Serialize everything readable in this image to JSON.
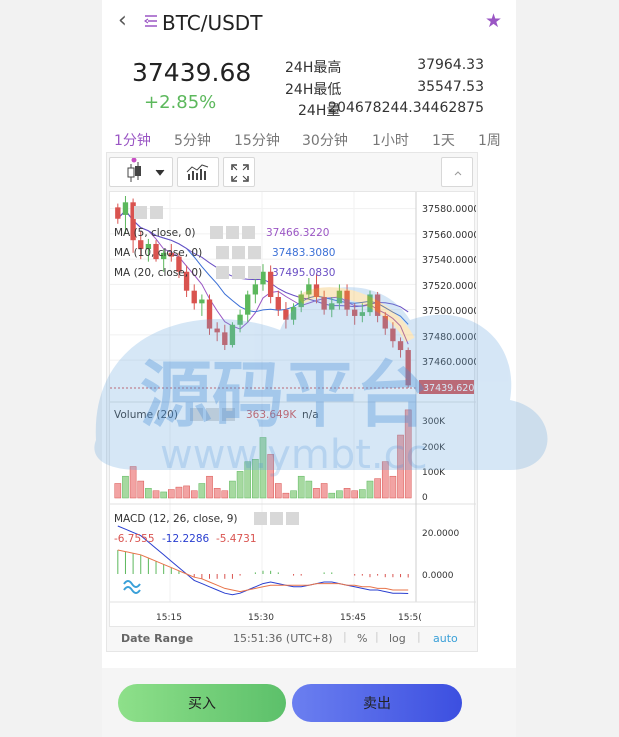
{
  "header": {
    "pair": "BTC/USDT"
  },
  "ticker": {
    "last_price": "37439.68",
    "change": "+2.85%",
    "high_label": "24H最高",
    "high_value": "37964.33",
    "low_label": "24H最低",
    "low_value": "35547.53",
    "volume_label": "24H量",
    "volume_value": "204678244.34462875"
  },
  "intervals": [
    {
      "label": "1分钟",
      "active": true
    },
    {
      "label": "5分钟"
    },
    {
      "label": "15分钟"
    },
    {
      "label": "30分钟"
    },
    {
      "label": "1小时"
    },
    {
      "label": "1天"
    },
    {
      "label": "1周"
    }
  ],
  "chart": {
    "ma_rows": [
      {
        "label": "MA (5, close, 0)",
        "value": "37466.3220",
        "color": "#9a56c4"
      },
      {
        "label": "MA (10, close, 0)",
        "value": "37483.3080",
        "color": "#3b6fd6"
      },
      {
        "label": "MA (20, close, 0)",
        "value": "37495.0830",
        "color": "#6a4fc4"
      }
    ],
    "price_ticks": [
      "37580.0000",
      "37560.0000",
      "37540.0000",
      "37520.0000",
      "37500.0000",
      "37480.0000",
      "37460.0000"
    ],
    "last_price_tag": "37439.6200",
    "volume_label": "Volume (20)",
    "volume_value": "363.649K",
    "volume_na": "n/a",
    "volume_ticks": [
      "300K",
      "200K",
      "100K",
      "0"
    ],
    "macd_label": "MACD (12, 26, close, 9)",
    "macd_values": [
      "-6.7555",
      "-12.2286",
      "-5.4731"
    ],
    "macd_ticks": [
      "20.0000",
      "0.0000"
    ],
    "time_ticks": [
      "15:15",
      "15:30",
      "15:45",
      "15:5("
    ],
    "date_range": "Date Range",
    "clock": "15:51:36 (UTC+8)",
    "percent": "%",
    "log": "log",
    "auto": "auto"
  },
  "chart_data": {
    "type": "candlestick",
    "ylim": [
      37430,
      37590
    ],
    "candles": [
      [
        37581,
        37584,
        37568,
        37572
      ],
      [
        37575,
        37590,
        37560,
        37585
      ],
      [
        37585,
        37588,
        37545,
        37555
      ],
      [
        37555,
        37562,
        37540,
        37548
      ],
      [
        37548,
        37556,
        37538,
        37552
      ],
      [
        37552,
        37555,
        37538,
        37540
      ],
      [
        37540,
        37548,
        37530,
        37545
      ],
      [
        37545,
        37552,
        37538,
        37542
      ],
      [
        37542,
        37545,
        37525,
        37530
      ],
      [
        37530,
        37535,
        37510,
        37515
      ],
      [
        37515,
        37520,
        37500,
        37505
      ],
      [
        37505,
        37512,
        37495,
        37508
      ],
      [
        37508,
        37512,
        37480,
        37485
      ],
      [
        37485,
        37490,
        37475,
        37482
      ],
      [
        37482,
        37488,
        37468,
        37472
      ],
      [
        37472,
        37490,
        37470,
        37488
      ],
      [
        37488,
        37500,
        37482,
        37496
      ],
      [
        37496,
        37515,
        37490,
        37512
      ],
      [
        37512,
        37525,
        37505,
        37520
      ],
      [
        37520,
        37536,
        37515,
        37530
      ],
      [
        37530,
        37535,
        37505,
        37510
      ],
      [
        37510,
        37515,
        37495,
        37500
      ],
      [
        37500,
        37506,
        37485,
        37492
      ],
      [
        37492,
        37505,
        37488,
        37502
      ],
      [
        37502,
        37515,
        37498,
        37512
      ],
      [
        37512,
        37525,
        37508,
        37520
      ],
      [
        37520,
        37528,
        37505,
        37510
      ],
      [
        37510,
        37515,
        37496,
        37500
      ],
      [
        37500,
        37510,
        37494,
        37505
      ],
      [
        37505,
        37520,
        37500,
        37515
      ],
      [
        37515,
        37520,
        37495,
        37500
      ],
      [
        37500,
        37505,
        37488,
        37495
      ],
      [
        37495,
        37505,
        37490,
        37498
      ],
      [
        37498,
        37515,
        37495,
        37512
      ],
      [
        37512,
        37514,
        37490,
        37495
      ],
      [
        37495,
        37498,
        37480,
        37485
      ],
      [
        37485,
        37490,
        37470,
        37475
      ],
      [
        37475,
        37478,
        37462,
        37468
      ],
      [
        37468,
        37470,
        37438,
        37440
      ]
    ],
    "volume": [
      60,
      90,
      130,
      70,
      40,
      30,
      25,
      35,
      45,
      50,
      30,
      60,
      90,
      40,
      30,
      70,
      110,
      150,
      160,
      250,
      180,
      60,
      20,
      30,
      90,
      70,
      40,
      60,
      20,
      30,
      40,
      30,
      35,
      70,
      80,
      150,
      90,
      260,
      364
    ],
    "volume_ylim": [
      0,
      380
    ],
    "macd_line": [
      30,
      28,
      26,
      24,
      20,
      16,
      12,
      8,
      4,
      0,
      -4,
      -6,
      -8,
      -10,
      -12,
      -13,
      -12,
      -10,
      -8,
      -6,
      -5,
      -6,
      -7,
      -8,
      -8,
      -7,
      -6,
      -5,
      -5,
      -6,
      -7,
      -8,
      -9,
      -10,
      -10,
      -11,
      -12,
      -12,
      -12.2
    ],
    "signal_line": [
      15,
      14,
      13,
      12,
      10,
      8,
      6,
      4,
      2,
      0,
      -2,
      -3,
      -5,
      -7,
      -9,
      -10,
      -11,
      -10,
      -9,
      -8,
      -7,
      -7,
      -7,
      -7,
      -7,
      -7,
      -6,
      -6,
      -6,
      -6,
      -7,
      -7,
      -8,
      -8,
      -9,
      -9,
      -10,
      -10,
      -10
    ]
  },
  "actions": {
    "buy": "买入",
    "sell": "卖出"
  },
  "watermark": {
    "cn": "源码平台",
    "url": "www.ymbt.cc"
  }
}
